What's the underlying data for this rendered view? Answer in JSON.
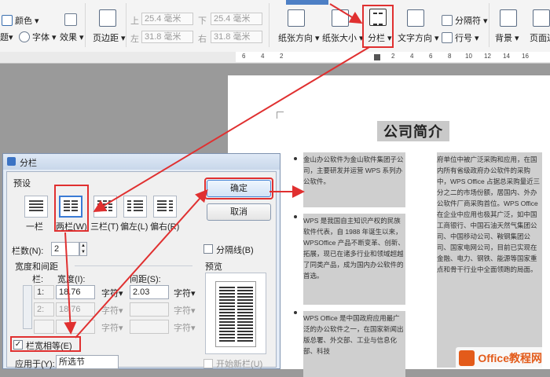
{
  "ribbon": {
    "color_label": "颜色",
    "font_label": "字体",
    "effects_label": "效果",
    "margins_label": "页边距",
    "top_label": "上",
    "top_value": "25.4 毫米",
    "bottom_label": "下",
    "bottom_value": "25.4 毫米",
    "left_label": "左",
    "left_value": "31.8 毫米",
    "right_label": "右",
    "right_value": "31.8 毫米",
    "orientation_label": "纸张方向",
    "size_label": "纸张大小",
    "columns_label": "分栏",
    "text_direction_label": "文字方向",
    "separator_label": "分隔符",
    "line_number_label": "行号",
    "background_label": "背景",
    "page_border_label": "页面边"
  },
  "ruler": {
    "ticks": [
      "6",
      "4",
      "2",
      "",
      "2",
      "4",
      "6",
      "8",
      "10",
      "12",
      "14",
      "16"
    ]
  },
  "document": {
    "title": "公司简介",
    "left_paragraphs": [
      "金山办公软件为金山软件集团子公司，主要研发并运营 WPS 系列办公软件。",
      "WPS 是我国自主知识产权的民族软件代表，自 1988 年诞生以来，WPSOffice 产品不断变革、创新、拓展，现已在诸多行业和领域超越了同类产品，成为国内办公软件的首选。",
      "WPS Office 是中国政府应用最广泛的办公软件之一，在国家新闻出版总署、外交部、工业与信息化部、科技"
    ],
    "right_paragraphs": [
      "府单位中被广泛采购和应用，在国内所有省级政府办公软件的采购中，WPS Office 占据总采购量近三分之二的市场份额，居国内、外办公软件厂商采购首位。WPS Office 在企业中应用也极其广泛，如中国工商银行、中国石油天然气集团公司、中国移动公司、鞍钢集团公司、国家电网公司，目前已实现在金融、电力、钢铁、能源等国家重点和骨干行业中全面领跑的局面。"
    ]
  },
  "dialog": {
    "title": "分栏",
    "preset_label": "预设",
    "presets": [
      "一栏",
      "两栏(W)",
      "三栏(T)",
      "偏左(L)",
      "偏右(R)"
    ],
    "ok_label": "确定",
    "cancel_label": "取消",
    "col_count_label": "栏数(N):",
    "col_count_value": "2",
    "separator_label": "分隔线(B)",
    "width_spacing_label": "宽度和间距",
    "col_header": "栏:",
    "width_header": "宽度(I):",
    "spacing_header": "间距(S):",
    "rows": [
      {
        "num": "1:",
        "width": "18.76",
        "unit1": "字符▾",
        "spacing": "2.03",
        "unit2": "字符▾"
      },
      {
        "num": "2:",
        "width": "18.76",
        "unit1": "字符▾",
        "spacing": "",
        "unit2": "字符▾"
      },
      {
        "num": "",
        "width": "",
        "unit1": "字符▾",
        "spacing": "",
        "unit2": "字符▾"
      }
    ],
    "equal_width_label": "栏宽相等(E)",
    "preview_label": "预览",
    "apply_label": "应用于(Y):",
    "apply_value": "所选节",
    "new_col_label": "开始新栏(U)"
  },
  "watermark": {
    "text": "Office教程网"
  },
  "colors": {
    "accent_red": "#e03030",
    "dialog_frame": "#7f93b0",
    "office_orange": "#e35b1a"
  }
}
